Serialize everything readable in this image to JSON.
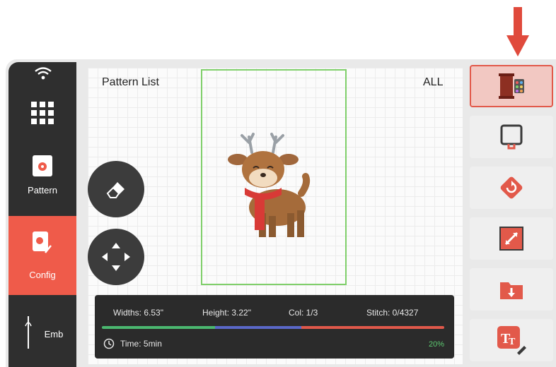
{
  "canvas": {
    "title": "Pattern List",
    "filter": "ALL"
  },
  "sidebar": {
    "items": [
      {
        "label": "Pattern"
      },
      {
        "label": "Config"
      },
      {
        "label": "Emb"
      }
    ]
  },
  "info": {
    "widths": "Widths: 6.53\"",
    "height": "Height: 3.22\"",
    "col": "Col: 1/3",
    "stitch": "Stitch: 0/4327",
    "time": "Time: 5min",
    "percent": "20%",
    "progress_colors": [
      "#4bb870",
      "#5a68c8",
      "#e0584a"
    ]
  },
  "colors": {
    "accent": "#ef5b4a",
    "frame": "#7fcf6a"
  }
}
